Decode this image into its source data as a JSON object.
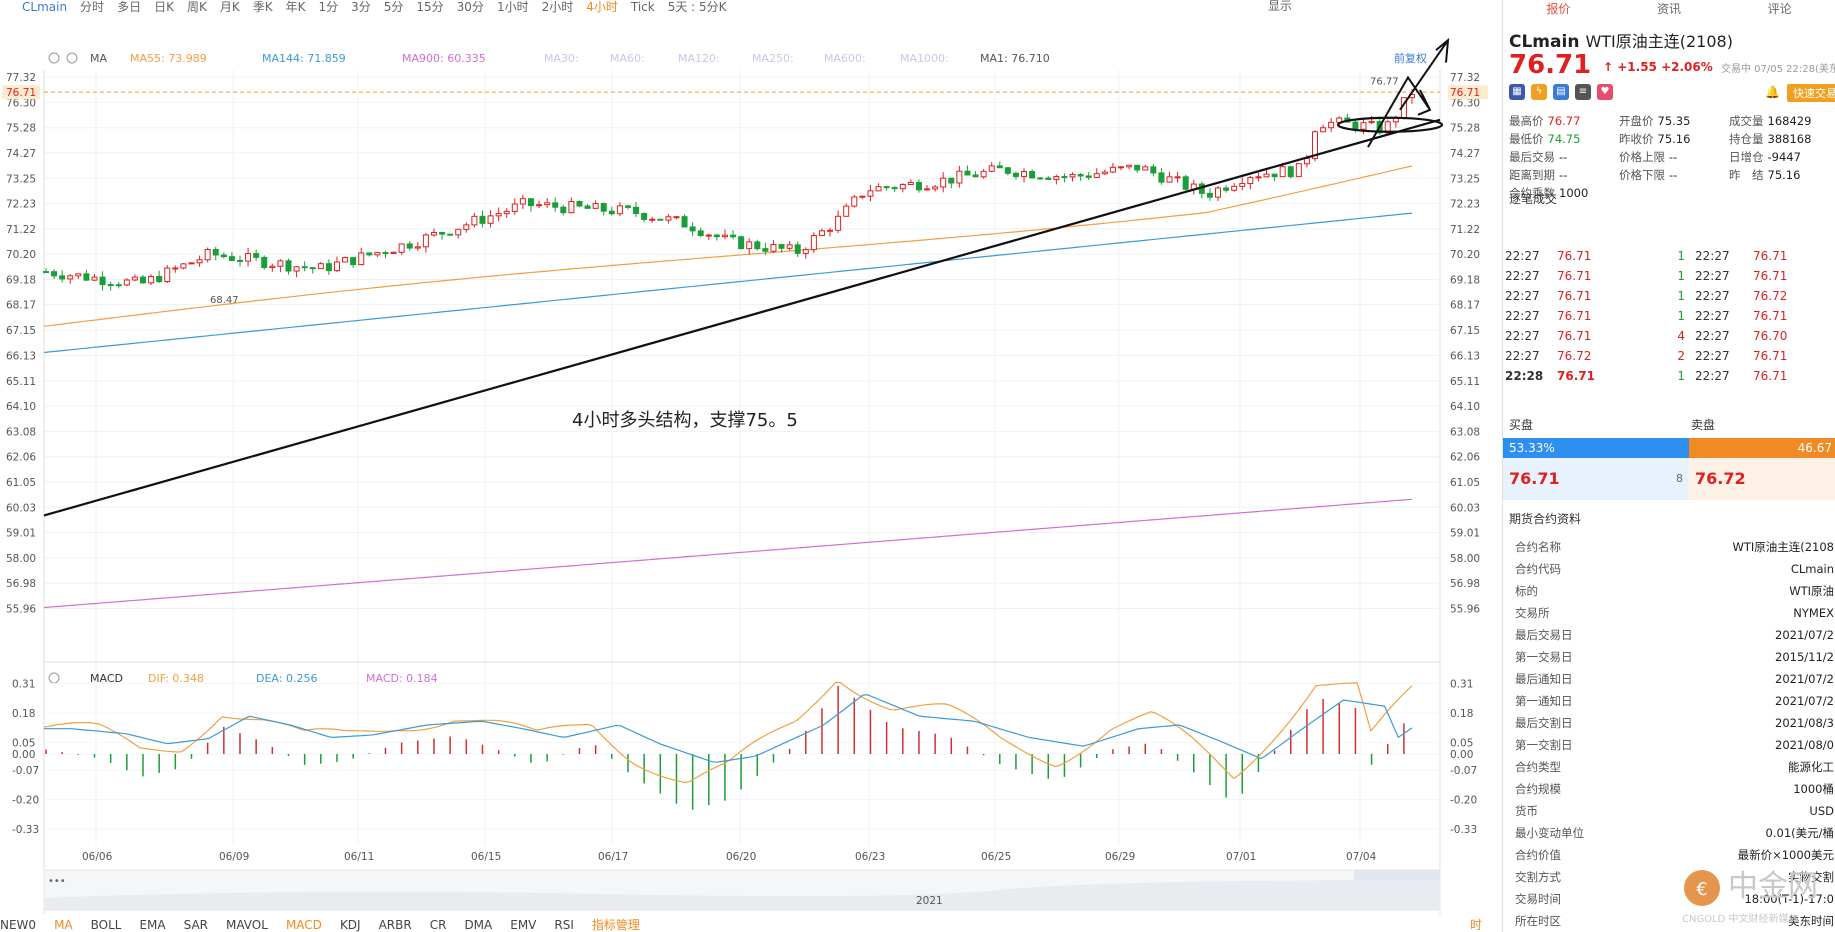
{
  "toolbar": {
    "symbol": "CLmain",
    "periods": [
      "分时",
      "多日",
      "日K",
      "周K",
      "月K",
      "季K",
      "年K",
      "1分",
      "3分",
      "5分",
      "15分",
      "30分",
      "1小时",
      "2小时",
      "4小时",
      "Tick",
      "5天 : 5分K"
    ],
    "active_period": "4小时",
    "display_label": "显示"
  },
  "chart_header": {
    "ma_label": "MA",
    "ma55": "MA55: 73.989",
    "ma144": "MA144: 71.859",
    "ma900": "MA900: 60.335",
    "ma30": "MA30:",
    "ma60": "MA60:",
    "ma120": "MA120:",
    "ma250": "MA250:",
    "ma600": "MA600:",
    "ma1000": "MA1000:",
    "ma1": "MA1: 76.710",
    "fuquan": "前复权",
    "colors": {
      "ma55": "#f0a040",
      "ma144": "#3a9bd5",
      "ma900": "#d070d0",
      "ma1": "#555555",
      "faded": "#c8c8e8"
    }
  },
  "macd_header": {
    "label": "MACD",
    "dif": "DIF: 0.348",
    "dea": "DEA: 0.256",
    "macd": "MACD: 0.184"
  },
  "price_axis": [
    "77.32",
    "76.30",
    "75.28",
    "74.27",
    "73.25",
    "72.23",
    "71.22",
    "70.20",
    "69.18",
    "68.17",
    "67.15",
    "66.13",
    "65.11",
    "64.10",
    "63.08",
    "62.06",
    "61.05",
    "60.03",
    "59.01",
    "58.00",
    "56.98",
    "55.96"
  ],
  "current_price_tag": "76.71",
  "macd_axis": [
    "0.31",
    "0.18",
    "0.05",
    "0.00",
    "-0.07",
    "-0.20",
    "-0.33"
  ],
  "dates": [
    "06/06",
    "06/09",
    "06/11",
    "06/15",
    "06/17",
    "06/20",
    "06/23",
    "06/25",
    "06/29",
    "07/01",
    "07/04"
  ],
  "annotations": {
    "high_label": "76.77",
    "low_label": "68.47",
    "note": "4小时多头结构，支撑75。5"
  },
  "navigator_year": "2021",
  "bottom_indicators": [
    "NEW0",
    "MA",
    "BOLL",
    "EMA",
    "SAR",
    "MAVOL",
    "MACD",
    "KDJ",
    "ARBR",
    "CR",
    "DMA",
    "EMV",
    "RSI",
    "指标管理"
  ],
  "bottom_active": [
    "MA",
    "MACD"
  ],
  "bottom_right": "时段",
  "right_panel": {
    "tabs": [
      "报价",
      "资讯",
      "评论"
    ],
    "active_tab": "报价",
    "symbol": "CLmain",
    "name": "WTI原油主连(2108)",
    "price": "76.71",
    "change": "+1.55",
    "change_pct": "+2.06%",
    "trade_time": "交易中 07/05 22:28(美东",
    "quick_trade": "快速交易",
    "stats": [
      [
        [
          "最高价",
          "76.77"
        ],
        [
          "开盘价",
          "75.35"
        ],
        [
          "成交量",
          "168429"
        ]
      ],
      [
        [
          "最低价",
          "74.75"
        ],
        [
          "昨收价",
          "75.16"
        ],
        [
          "持仓量",
          "388168"
        ]
      ],
      [
        [
          "最后交易",
          "--"
        ],
        [
          "价格上限",
          "--"
        ],
        [
          "日增仓",
          "-9447"
        ]
      ],
      [
        [
          "距离到期",
          "--"
        ],
        [
          "价格下限",
          "--"
        ],
        [
          "昨　结",
          "75.16"
        ]
      ],
      [
        [
          "合约乘数",
          "1000"
        ]
      ]
    ],
    "ticks_title": "逐笔成交",
    "ticks": [
      [
        "22:27",
        "76.71",
        "1",
        "22:27",
        "76.71"
      ],
      [
        "22:27",
        "76.71",
        "1",
        "22:27",
        "76.71"
      ],
      [
        "22:27",
        "76.71",
        "1",
        "22:27",
        "76.72"
      ],
      [
        "22:27",
        "76.71",
        "1",
        "22:27",
        "76.71"
      ],
      [
        "22:27",
        "76.71",
        "4",
        "22:27",
        "76.70"
      ],
      [
        "22:27",
        "76.72",
        "2",
        "22:27",
        "76.71"
      ],
      [
        "22:28",
        "76.71",
        "1",
        "22:27",
        "76.71"
      ]
    ],
    "buy_label": "买盘",
    "sell_label": "卖盘",
    "buy_pct": "53.33%",
    "sell_pct": "46.67",
    "bid": "76.71",
    "bid_size": "8",
    "ask": "76.72",
    "info_title": "期货合约资料",
    "info": [
      [
        "合约名称",
        "WTI原油主连(2108"
      ],
      [
        "合约代码",
        "CLmain"
      ],
      [
        "标的",
        "WTI原油"
      ],
      [
        "交易所",
        "NYMEX"
      ],
      [
        "最后交易日",
        "2021/07/2"
      ],
      [
        "第一交易日",
        "2015/11/2"
      ],
      [
        "最后通知日",
        "2021/07/2"
      ],
      [
        "第一通知日",
        "2021/07/2"
      ],
      [
        "最后交割日",
        "2021/08/3"
      ],
      [
        "第一交割日",
        "2021/08/0"
      ],
      [
        "合约类型",
        "能源化工"
      ],
      [
        "合约规模",
        "1000桶"
      ],
      [
        "货币",
        "USD"
      ],
      [
        "最小变动单位",
        "0.01(美元/桶"
      ],
      [
        "合约价值",
        "最新价×1000美元"
      ],
      [
        "交割方式",
        "实物交割"
      ],
      [
        "交易时间",
        "18:00(T-1)-17:0"
      ],
      [
        "所在时区",
        "美东时间"
      ]
    ],
    "watermark": "中金网",
    "watermark_sub": "CNGOLD 中文财经新媒体"
  }
}
